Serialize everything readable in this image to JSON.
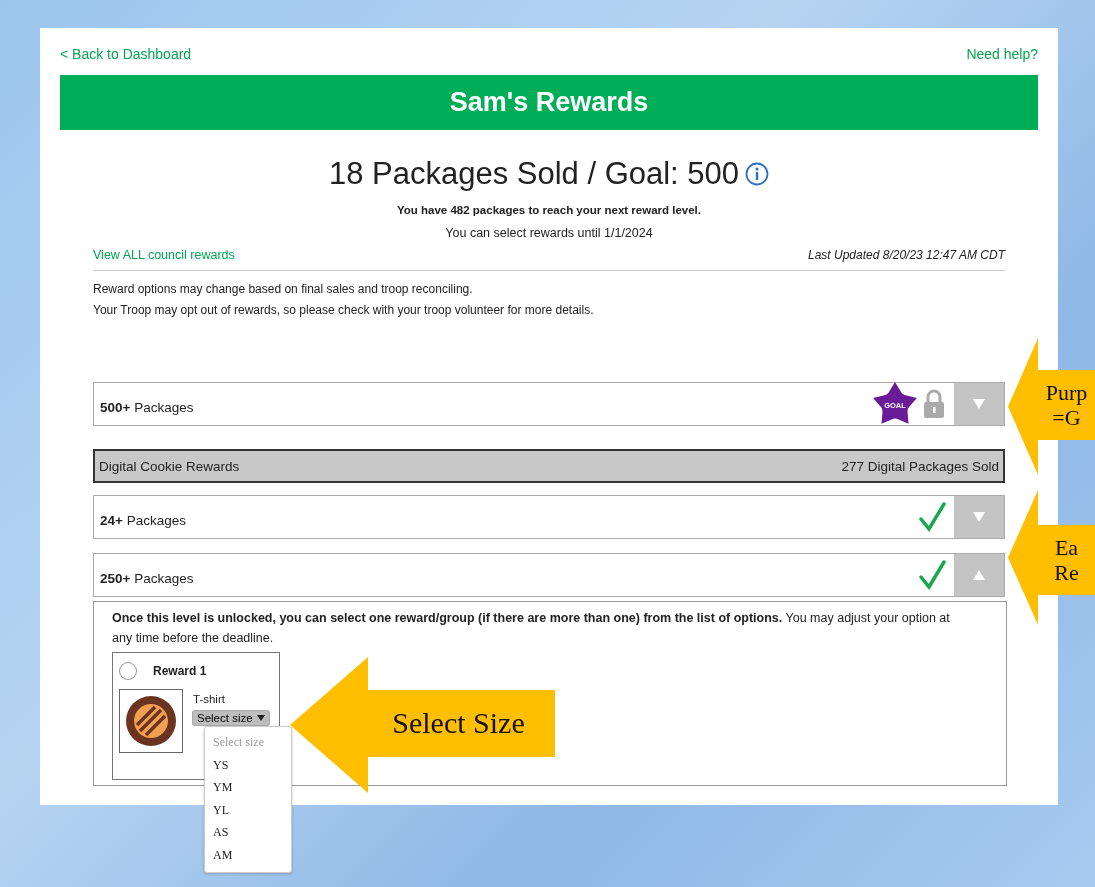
{
  "nav": {
    "back_link": "< Back to Dashboard",
    "help_link": "Need help?"
  },
  "banner": {
    "title": "Sam's Rewards"
  },
  "summary": {
    "headline": "18 Packages Sold / Goal: 500",
    "remaining": "You have 482 packages to reach your next reward level.",
    "deadline": "You can select rewards until 1/1/2024"
  },
  "links": {
    "council_rewards": "View ALL council rewards",
    "last_updated": "Last Updated 8/20/23 12:47 AM CDT"
  },
  "notice": [
    "Reward options may change based on final sales and troop reconciling.",
    "Your Troop may opt out of rewards, so please check with your troop volunteer for more details."
  ],
  "levels": [
    {
      "kind": "level",
      "count": "500+",
      "label": "Packages",
      "locked": true,
      "earned": false,
      "badge": "GOAL",
      "expanded": false
    },
    {
      "kind": "digital",
      "label": "Digital Cookie Rewards",
      "value": "277 Digital Packages Sold"
    },
    {
      "kind": "level",
      "count": "24+",
      "label": "Packages",
      "locked": false,
      "earned": true,
      "expanded": false
    },
    {
      "kind": "level",
      "count": "250+",
      "label": "Packages",
      "locked": false,
      "earned": true,
      "expanded": true,
      "detail": {
        "intro": "**Once this level is unlocked, you can select one reward/group (if there are more than one) from the list of options.** You may adjust your option at any time before the deadline.",
        "rewards": [
          {
            "title": "Reward 1",
            "selected": false,
            "item": "T-shirt",
            "size_select": {
              "value": "Select size",
              "open": true,
              "options_header": "Select size",
              "options": [
                "YS",
                "YM",
                "YL",
                "AS",
                "AM"
              ]
            }
          }
        ]
      }
    }
  ],
  "callouts": [
    {
      "lines": [
        "Purp",
        "=G"
      ]
    },
    {
      "lines": [
        "Ea",
        "Re"
      ]
    },
    {
      "lines": [
        "Select Size"
      ]
    }
  ]
}
